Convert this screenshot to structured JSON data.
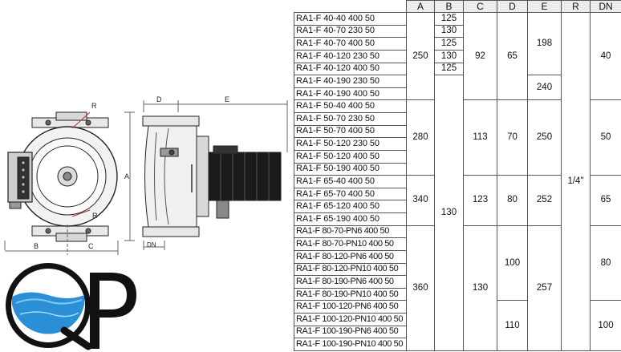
{
  "drawing": {
    "front_labels": {
      "R_top": "R",
      "R_bottom": "R",
      "A": "A",
      "B": "B",
      "C": "C"
    },
    "side_labels": {
      "D": "D",
      "E": "E",
      "DN": "DN"
    }
  },
  "logo": {
    "text": "QP"
  },
  "table": {
    "headers": [
      "",
      "A",
      "B",
      "C",
      "D",
      "E",
      "R",
      "DN"
    ],
    "models": [
      "RA1-F 40-40 400 50",
      "RA1-F 40-70 230 50",
      "RA1-F 40-70 400 50",
      "RA1-F 40-120 230 50",
      "RA1-F 40-120 400 50",
      "RA1-F 40-190 230 50",
      "RA1-F 40-190 400 50",
      "RA1-F 50-40 400 50",
      "RA1-F 50-70 230 50",
      "RA1-F 50-70 400 50",
      "RA1-F 50-120 230 50",
      "RA1-F 50-120 400 50",
      "RA1-F 50-190 400 50",
      "RA1-F 65-40 400 50",
      "RA1-F 65-70 400 50",
      "RA1-F 65-120 400 50",
      "RA1-F 65-190 400 50",
      "RA1-F 80-70-PN6 400 50",
      "RA1-F 80-70-PN10 400 50",
      "RA1-F 80-120-PN6 400 50",
      "RA1-F 80-120-PN10 400 50",
      "RA1-F 80-190-PN6 400 50",
      "RA1-F 80-190-PN10 400 50",
      "RA1-F 100-120-PN6 400 50",
      "RA1-F 100-120-PN10 400 50",
      "RA1-F 100-190-PN6 400 50",
      "RA1-F 100-190-PN10 400 50"
    ],
    "A": [
      "250",
      "280",
      "340",
      "360"
    ],
    "B": [
      "125",
      "130",
      "125",
      "130",
      "125",
      "130"
    ],
    "C": [
      "92",
      "113",
      "123",
      "130"
    ],
    "D": [
      "65",
      "70",
      "80",
      "100",
      "110"
    ],
    "E": [
      "198",
      "240",
      "250",
      "252",
      "257"
    ],
    "R": "1/4\"",
    "DN": [
      "40",
      "50",
      "65",
      "80",
      "100"
    ]
  },
  "colors": {
    "header_bg": "#ececec",
    "logo_water": "#2a8fd6",
    "motor": "#1a1a1a"
  }
}
